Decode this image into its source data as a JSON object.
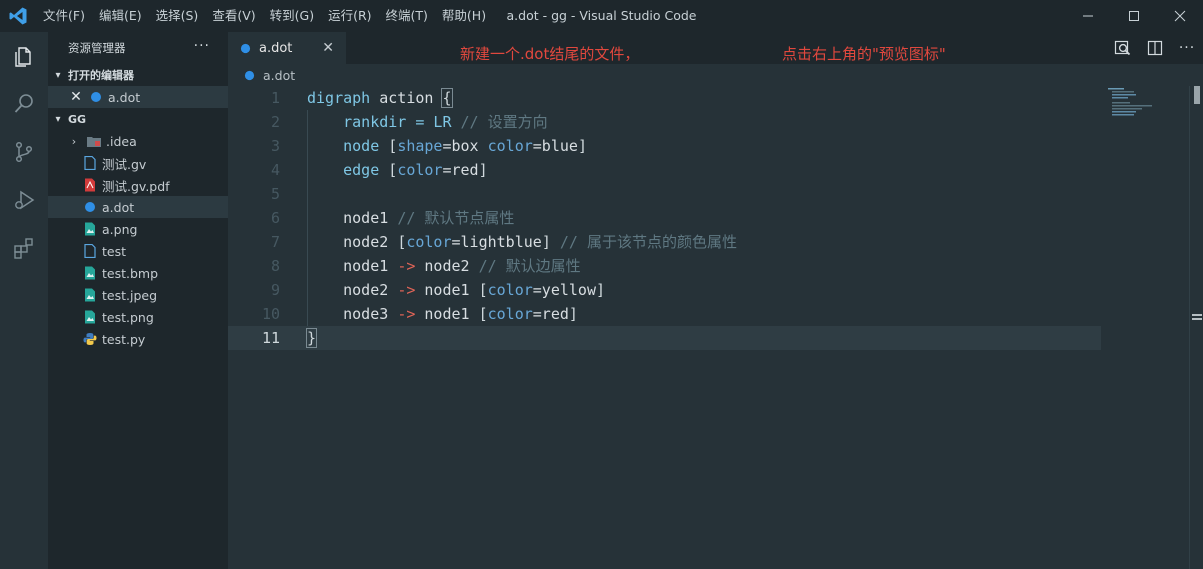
{
  "titlebar": {
    "title": "a.dot - gg - Visual Studio Code",
    "menu": [
      "文件(F)",
      "编辑(E)",
      "选择(S)",
      "查看(V)",
      "转到(G)",
      "运行(R)",
      "终端(T)",
      "帮助(H)"
    ]
  },
  "sidebar": {
    "header": "资源管理器",
    "more": "···",
    "open_editors_title": "打开的编辑器",
    "open_editor_file": "a.dot",
    "folder_title": "GG",
    "files": [
      {
        "name": ".idea",
        "icon": "folder-icon"
      },
      {
        "name": "测试.gv",
        "icon": "file-icon"
      },
      {
        "name": "测试.gv.pdf",
        "icon": "pdf-icon"
      },
      {
        "name": "a.dot",
        "icon": "dot-file-icon"
      },
      {
        "name": "a.png",
        "icon": "image-icon"
      },
      {
        "name": "test",
        "icon": "file-icon"
      },
      {
        "name": "test.bmp",
        "icon": "image-icon"
      },
      {
        "name": "test.jpeg",
        "icon": "image-icon"
      },
      {
        "name": "test.png",
        "icon": "image-icon"
      },
      {
        "name": "test.py",
        "icon": "python-icon"
      }
    ]
  },
  "editor": {
    "tab_label": "a.dot",
    "breadcrumb": "a.dot",
    "note_left": "新建一个.dot结尾的文件，",
    "note_right": "点击右上角的\"预览图标\"",
    "line_numbers": [
      "1",
      "2",
      "3",
      "4",
      "5",
      "6",
      "7",
      "8",
      "9",
      "10",
      "11"
    ],
    "code": {
      "l1": {
        "kw": "digraph",
        "id": " action ",
        "br": "{"
      },
      "l2": {
        "id": "    rankdir = LR ",
        "cm": "// 设置方向"
      },
      "l3": {
        "id": "    node ",
        "b1": "[",
        "a1": "shape",
        "v1": "=box ",
        "a2": "color",
        "v2": "=blue",
        "b2": "]"
      },
      "l4": {
        "id": "    edge ",
        "b1": "[",
        "a1": "color",
        "v1": "=red",
        "b2": "]"
      },
      "l6": {
        "id": "    node1 ",
        "cm": "// 默认节点属性"
      },
      "l7": {
        "id": "    node2 ",
        "b1": "[",
        "a1": "color",
        "v1": "=lightblue",
        "b2": "]",
        "cm": " // 属于该节点的颜色属性"
      },
      "l8": {
        "id": "    node1 ",
        "op": "->",
        "id2": " node2 ",
        "cm": "// 默认边属性"
      },
      "l9": {
        "id": "    node2 ",
        "op": "->",
        "id2": " node1 ",
        "b1": "[",
        "a1": "color",
        "v1": "=yellow",
        "b2": "]"
      },
      "l10": {
        "id": "    node3 ",
        "op": "->",
        "id2": " node1 ",
        "b1": "[",
        "a1": "color",
        "v1": "=red",
        "b2": "]"
      },
      "l11": {
        "br": "}"
      }
    }
  }
}
